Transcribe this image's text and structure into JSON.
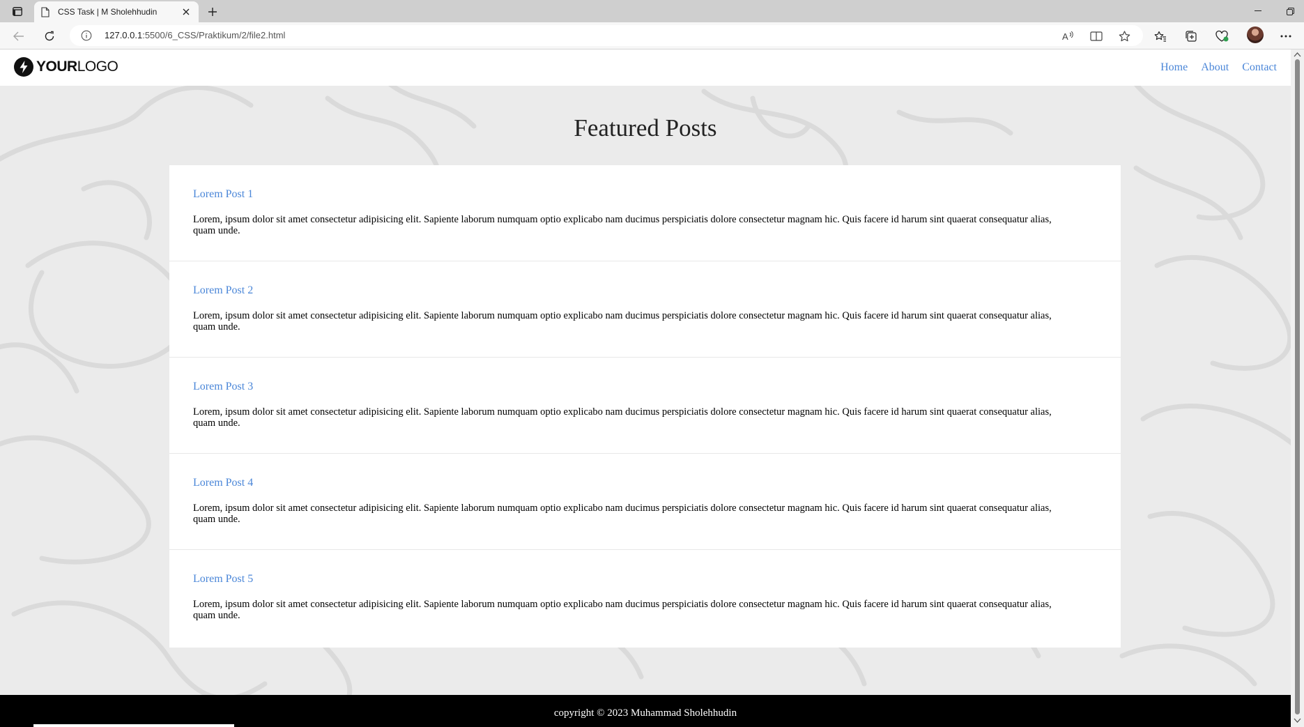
{
  "browser": {
    "tab_title": "CSS Task | M Sholehhudin",
    "url_host": "127.0.0.1",
    "url_rest": ":5500/6_CSS/Praktikum/2/file2.html"
  },
  "site": {
    "logo_bold": "YOUR",
    "logo_light": "LOGO",
    "nav": [
      {
        "label": "Home"
      },
      {
        "label": "About"
      },
      {
        "label": "Contact"
      }
    ],
    "heading": "Featured Posts",
    "posts": [
      {
        "title": "Lorem Post 1",
        "body": "Lorem, ipsum dolor sit amet consectetur adipisicing elit. Sapiente laborum numquam optio explicabo nam ducimus perspiciatis dolore consectetur magnam hic. Quis facere id harum sint quaerat consequatur alias, quam unde."
      },
      {
        "title": "Lorem Post 2",
        "body": "Lorem, ipsum dolor sit amet consectetur adipisicing elit. Sapiente laborum numquam optio explicabo nam ducimus perspiciatis dolore consectetur magnam hic. Quis facere id harum sint quaerat consequatur alias, quam unde."
      },
      {
        "title": "Lorem Post 3",
        "body": "Lorem, ipsum dolor sit amet consectetur adipisicing elit. Sapiente laborum numquam optio explicabo nam ducimus perspiciatis dolore consectetur magnam hic. Quis facere id harum sint quaerat consequatur alias, quam unde."
      },
      {
        "title": "Lorem Post 4",
        "body": "Lorem, ipsum dolor sit amet consectetur adipisicing elit. Sapiente laborum numquam optio explicabo nam ducimus perspiciatis dolore consectetur magnam hic. Quis facere id harum sint quaerat consequatur alias, quam unde."
      },
      {
        "title": "Lorem Post 5",
        "body": "Lorem, ipsum dolor sit amet consectetur adipisicing elit. Sapiente laborum numquam optio explicabo nam ducimus perspiciatis dolore consectetur magnam hic. Quis facere id harum sint quaerat consequatur alias, quam unde."
      }
    ],
    "footer": "copyright © 2023 Muhammad Sholehhudin"
  },
  "colors": {
    "link": "#4a86d8",
    "page_bg": "#ebebeb",
    "footer_bg": "#000000"
  }
}
